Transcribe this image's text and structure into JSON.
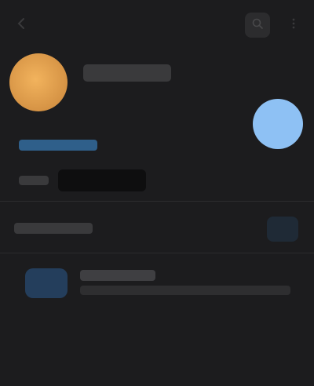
{
  "profile": {
    "display_name": ""
  },
  "colors": {
    "background": "#1c1c1e",
    "avatar": "#e9a44e",
    "accent": "#8ec1f4",
    "link": "#2f5f8a"
  },
  "icons": {
    "back": "back-arrow-icon",
    "search": "search-icon",
    "more": "more-icon",
    "fab": "message-icon"
  }
}
